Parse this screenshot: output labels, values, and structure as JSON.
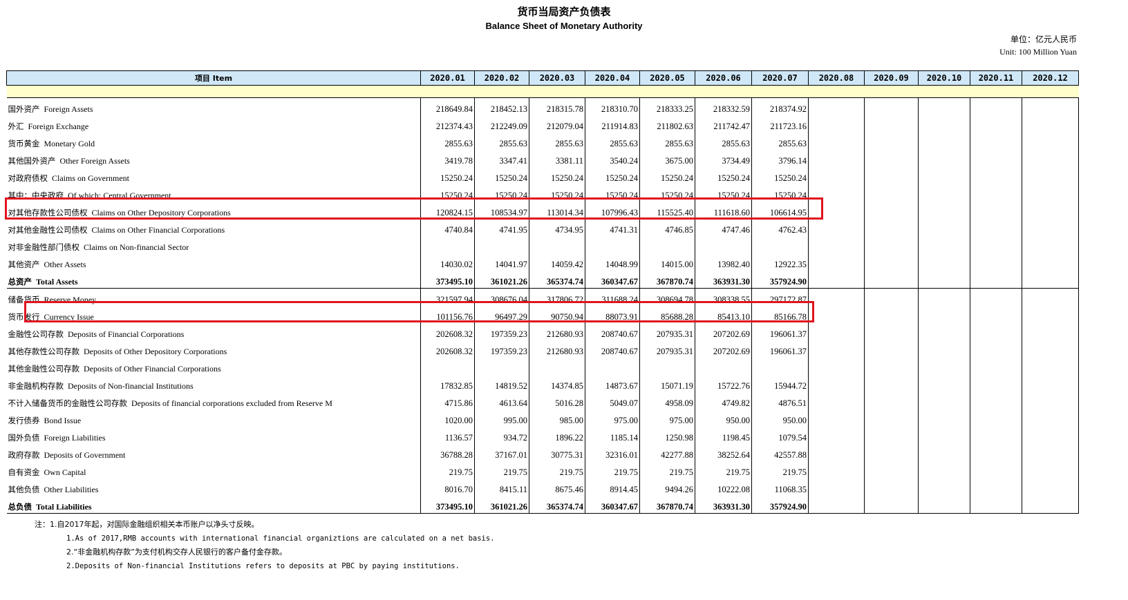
{
  "title_cn": "货币当局资产负债表",
  "title_en": "Balance Sheet of  Monetary Authority",
  "unit_cn": "单位：亿元人民币",
  "unit_en": "Unit: 100 Million Yuan",
  "header": {
    "item": "项目 Item",
    "months": [
      "2020.01",
      "2020.02",
      "2020.03",
      "2020.04",
      "2020.05",
      "2020.06",
      "2020.07",
      "2020.08",
      "2020.09",
      "2020.10",
      "2020.11",
      "2020.12"
    ]
  },
  "rows": [
    {
      "cn": "国外资产",
      "en": "Foreign Assets",
      "indent": 1,
      "values": [
        "218649.84",
        "218452.13",
        "218315.78",
        "218310.70",
        "218333.25",
        "218332.59",
        "218374.92"
      ]
    },
    {
      "cn": "外汇",
      "en": "Foreign Exchange",
      "indent": 2,
      "values": [
        "212374.43",
        "212249.09",
        "212079.04",
        "211914.83",
        "211802.63",
        "211742.47",
        "211723.16"
      ]
    },
    {
      "cn": "货币黄金",
      "en": "Monetary Gold",
      "indent": 2,
      "values": [
        "2855.63",
        "2855.63",
        "2855.63",
        "2855.63",
        "2855.63",
        "2855.63",
        "2855.63"
      ]
    },
    {
      "cn": "其他国外资产",
      "en": "Other Foreign Assets",
      "indent": 2,
      "values": [
        "3419.78",
        "3347.41",
        "3381.11",
        "3540.24",
        "3675.00",
        "3734.49",
        "3796.14"
      ]
    },
    {
      "cn": "对政府债权",
      "en": "Claims on Government",
      "indent": 1,
      "values": [
        "15250.24",
        "15250.24",
        "15250.24",
        "15250.24",
        "15250.24",
        "15250.24",
        "15250.24"
      ]
    },
    {
      "cn": "其中：中央政府",
      "en": "Of which: Central Government",
      "indent": 2,
      "values": [
        "15250.24",
        "15250.24",
        "15250.24",
        "15250.24",
        "15250.24",
        "15250.24",
        "15250.24"
      ]
    },
    {
      "cn": "对其他存款性公司债权",
      "en": "Claims on Other Depository Corporations",
      "indent": 1,
      "values": [
        "120824.15",
        "108534.97",
        "113014.34",
        "107996.43",
        "115525.40",
        "111618.60",
        "106614.95"
      ]
    },
    {
      "cn": "对其他金融性公司债权",
      "en": "Claims on Other Financial Corporations",
      "indent": 1,
      "values": [
        "4740.84",
        "4741.95",
        "4734.95",
        "4741.31",
        "4746.85",
        "4747.46",
        "4762.43"
      ]
    },
    {
      "cn": "对非金融性部门债权",
      "en": "Claims on Non-financial Sector",
      "indent": 1,
      "values": [
        "",
        "",
        "",
        "",
        "",
        "",
        ""
      ]
    },
    {
      "cn": "其他资产",
      "en": "Other Assets",
      "indent": 1,
      "values": [
        "14030.02",
        "14041.97",
        "14059.42",
        "14048.99",
        "14015.00",
        "13982.40",
        "12922.35"
      ]
    },
    {
      "cn": "总资产",
      "en": "Total Assets",
      "indent": 0,
      "total": true,
      "values": [
        "373495.10",
        "361021.26",
        "365374.74",
        "360347.67",
        "367870.74",
        "363931.30",
        "357924.90"
      ]
    },
    {
      "cn": "储备货币",
      "en": "Reserve Money",
      "indent": 1,
      "values": [
        "321597.94",
        "308676.04",
        "317806.72",
        "311688.24",
        "308694.78",
        "308338.55",
        "297172.87"
      ]
    },
    {
      "cn": "货币发行",
      "en": "Currency Issue",
      "indent": 2,
      "values": [
        "101156.76",
        "96497.29",
        "90750.94",
        "88073.91",
        "85688.28",
        "85413.10",
        "85166.78"
      ]
    },
    {
      "cn": "金融性公司存款",
      "en": "Deposits of  Financial Corporations",
      "indent": 2,
      "values": [
        "202608.32",
        "197359.23",
        "212680.93",
        "208740.67",
        "207935.31",
        "207202.69",
        "196061.37"
      ]
    },
    {
      "cn": "其他存款性公司存款",
      "en": "Deposits of  Other Depository Corporations",
      "indent": 3,
      "values": [
        "202608.32",
        "197359.23",
        "212680.93",
        "208740.67",
        "207935.31",
        "207202.69",
        "196061.37"
      ]
    },
    {
      "cn": "其他金融性公司存款",
      "en": "Deposits of  Other Financial Corporations",
      "indent": 3,
      "values": [
        "",
        "",
        "",
        "",
        "",
        "",
        ""
      ]
    },
    {
      "cn": "非金融机构存款",
      "en": "Deposits of  Non-financial Institutions",
      "indent": 2,
      "values": [
        "17832.85",
        "14819.52",
        "14374.85",
        "14873.67",
        "15071.19",
        "15722.76",
        "15944.72"
      ]
    },
    {
      "cn": "不计入储备货币的金融性公司存款",
      "en": "Deposits of financial corporations excluded from Reserve M",
      "indent": 1,
      "values": [
        "4715.86",
        "4613.64",
        "5016.28",
        "5049.07",
        "4958.09",
        "4749.82",
        "4876.51"
      ]
    },
    {
      "cn": "发行债券",
      "en": "Bond Issue",
      "indent": 1,
      "values": [
        "1020.00",
        "995.00",
        "985.00",
        "975.00",
        "975.00",
        "950.00",
        "950.00"
      ]
    },
    {
      "cn": "国外负债",
      "en": "Foreign Liabilities",
      "indent": 1,
      "values": [
        "1136.57",
        "934.72",
        "1896.22",
        "1185.14",
        "1250.98",
        "1198.45",
        "1079.54"
      ]
    },
    {
      "cn": "政府存款",
      "en": "Deposits of Government",
      "indent": 1,
      "values": [
        "36788.28",
        "37167.01",
        "30775.31",
        "32316.01",
        "42277.88",
        "38252.64",
        "42557.88"
      ]
    },
    {
      "cn": "自有资金",
      "en": "Own Capital",
      "indent": 1,
      "values": [
        "219.75",
        "219.75",
        "219.75",
        "219.75",
        "219.75",
        "219.75",
        "219.75"
      ]
    },
    {
      "cn": "其他负债",
      "en": "Other Liabilities",
      "indent": 1,
      "values": [
        "8016.70",
        "8415.11",
        "8675.46",
        "8914.45",
        "9494.26",
        "10222.08",
        "11068.35"
      ]
    },
    {
      "cn": "总负债",
      "en": "Total  Liabilities",
      "indent": 0,
      "total": true,
      "values": [
        "373495.10",
        "361021.26",
        "365374.74",
        "360347.67",
        "367870.74",
        "363931.30",
        "357924.90"
      ]
    }
  ],
  "notes": [
    "注：1.自2017年起，对国际金融组织相关本币账户以净头寸反映。",
    "1.As of 2017,RMB accounts with international financial organiztions are calculated on a net basis.",
    "2.“非金融机构存款”为支付机构交存人民银行的客户备付金存款。",
    "2.Deposits of Non-financial Institutions refers to deposits at PBC by paying institutions."
  ],
  "highlight_color": "#e0141e"
}
